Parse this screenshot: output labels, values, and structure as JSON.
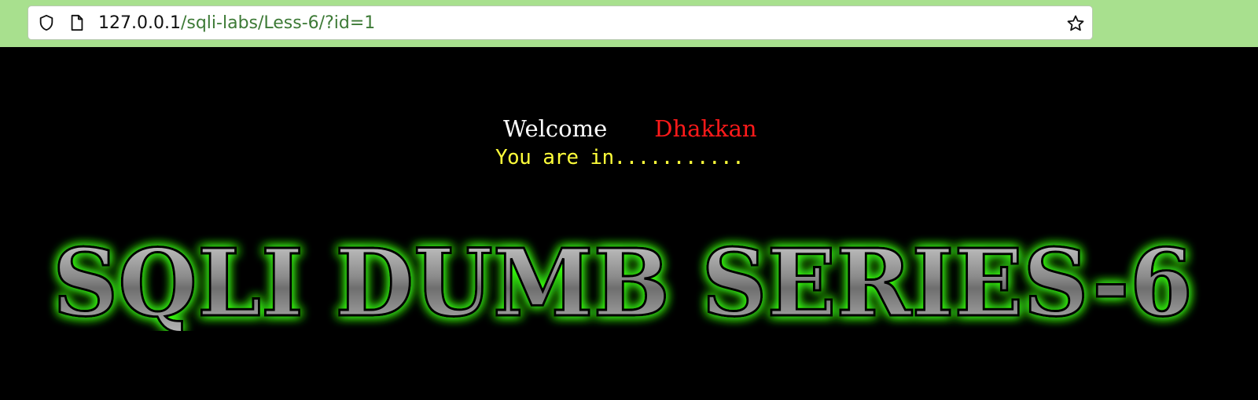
{
  "browser": {
    "url_host": "127.0.0.1",
    "url_path": "/sqli-labs/Less-6/?id=1"
  },
  "page": {
    "welcome_label": "Welcome",
    "welcome_name": "Dhakkan",
    "status_text": "You are in...........",
    "banner_text": "SQLI DUMB SERIES-6"
  },
  "colors": {
    "toolbar_bg": "#a8e08e",
    "page_bg": "#000000",
    "welcome": "#ffffff",
    "name": "#ff1a1a",
    "status": "#ffff3a",
    "banner_glow": "#39ff14",
    "banner_fill": "#8c8c8c"
  },
  "icons": [
    "shield-icon",
    "page-icon",
    "bookmark-star-icon"
  ]
}
